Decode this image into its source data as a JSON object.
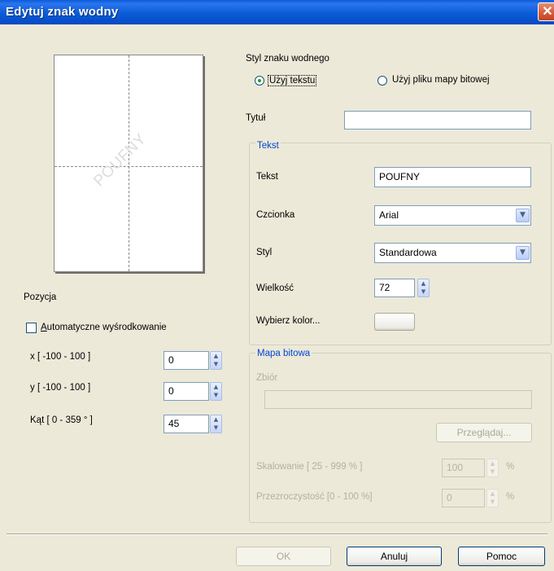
{
  "window": {
    "title": "Edytuj znak wodny",
    "close_symbol": "✕"
  },
  "preview": {
    "watermark_text": "POUFNY"
  },
  "position": {
    "title": "Pozycja",
    "auto_center_label": "Automatyczne wyśrodkowanie",
    "auto_center_checked": false,
    "x_label": "x [ -100 - 100 ]",
    "x_value": "0",
    "y_label": "y [ -100 - 100 ]",
    "y_value": "0",
    "angle_label": "Kąt [ 0 - 359 ° ]",
    "angle_value": "45"
  },
  "style": {
    "title": "Styl znaku wodnego",
    "use_text_label": "Użyj tekstu",
    "use_bitmap_label": "Użyj pliku mapy bitowej",
    "selected": "use_text"
  },
  "title_field": {
    "label": "Tytuł",
    "value": ""
  },
  "text_group": {
    "title": "Tekst",
    "text_label": "Tekst",
    "text_value": "POUFNY",
    "font_label": "Czcionka",
    "font_value": "Arial",
    "style_label": "Styl",
    "style_value": "Standardowa",
    "size_label": "Wielkość",
    "size_value": "72",
    "color_label": "Wybierz kolor..."
  },
  "bitmap_group": {
    "title": "Mapa bitowa",
    "file_label": "Zbiór",
    "file_value": "",
    "browse_label": "Przeglądaj...",
    "scale_label": "Skalowanie [ 25 - 999 % ]",
    "scale_value": "100",
    "scale_unit": "%",
    "transparency_label": "Przezroczystość [0 - 100 %]",
    "transparency_value": "0",
    "transparency_unit": "%"
  },
  "buttons": {
    "ok": "OK",
    "cancel": "Anuluj",
    "help": "Pomoc"
  },
  "colors": {
    "titlebar": "#0a5cd8",
    "dialog_bg": "#ece9d8",
    "group_title": "#0046d5",
    "close_button": "#d55a36",
    "radio_selected": "#21a121"
  }
}
